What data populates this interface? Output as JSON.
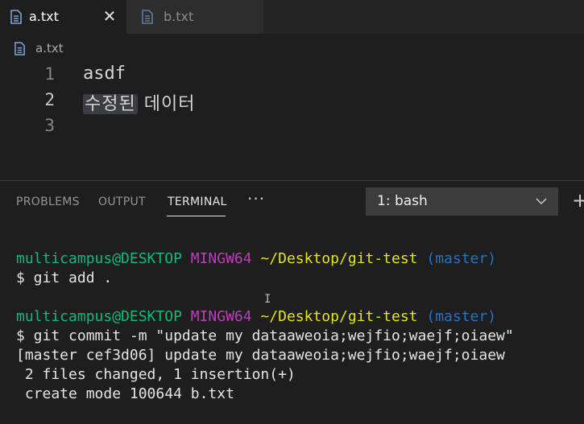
{
  "tabs": [
    {
      "label": "a.txt",
      "icon": "file-lines-icon",
      "active": true,
      "close": "✕"
    },
    {
      "label": "b.txt",
      "icon": "file-lines-icon",
      "active": false
    }
  ],
  "breadcrumb": {
    "file": "a.txt"
  },
  "editor": {
    "lines": [
      {
        "number": "1",
        "text": "asdf"
      },
      {
        "number": "2",
        "highlighted": "수정된",
        "rest": " 데이터"
      },
      {
        "number": "3",
        "text": ""
      }
    ]
  },
  "panel": {
    "tabs": [
      "PROBLEMS",
      "OUTPUT",
      "TERMINAL"
    ],
    "active_tab": "TERMINAL",
    "more": "···",
    "terminal_select": "1: bash",
    "plus": "+"
  },
  "terminal": {
    "prompt1": {
      "user": "multicampus@DESKTOP",
      "host": "MINGW64",
      "path": "~/Desktop/git-test",
      "branch": "(master)"
    },
    "cmd1": "$ git add .",
    "prompt2": {
      "user": "multicampus@DESKTOP",
      "host": "MINGW64",
      "path": "~/Desktop/git-test",
      "branch": "(master)"
    },
    "cmd2": "$ git commit -m \"update my dataaweoia;wejfio;waejf;oiaew\"",
    "out1": "[master cef3d06] update my dataaweoia;wejfio;waejf;oiaew",
    "out2": " 2 files changed, 1 insertion(+)",
    "out3": " create mode 100644 b.txt",
    "cursor": "I"
  },
  "colors": {
    "user": "#0dbc79",
    "host": "#bc3fbc",
    "path": "#e5e510",
    "branch": "#2472c8"
  }
}
